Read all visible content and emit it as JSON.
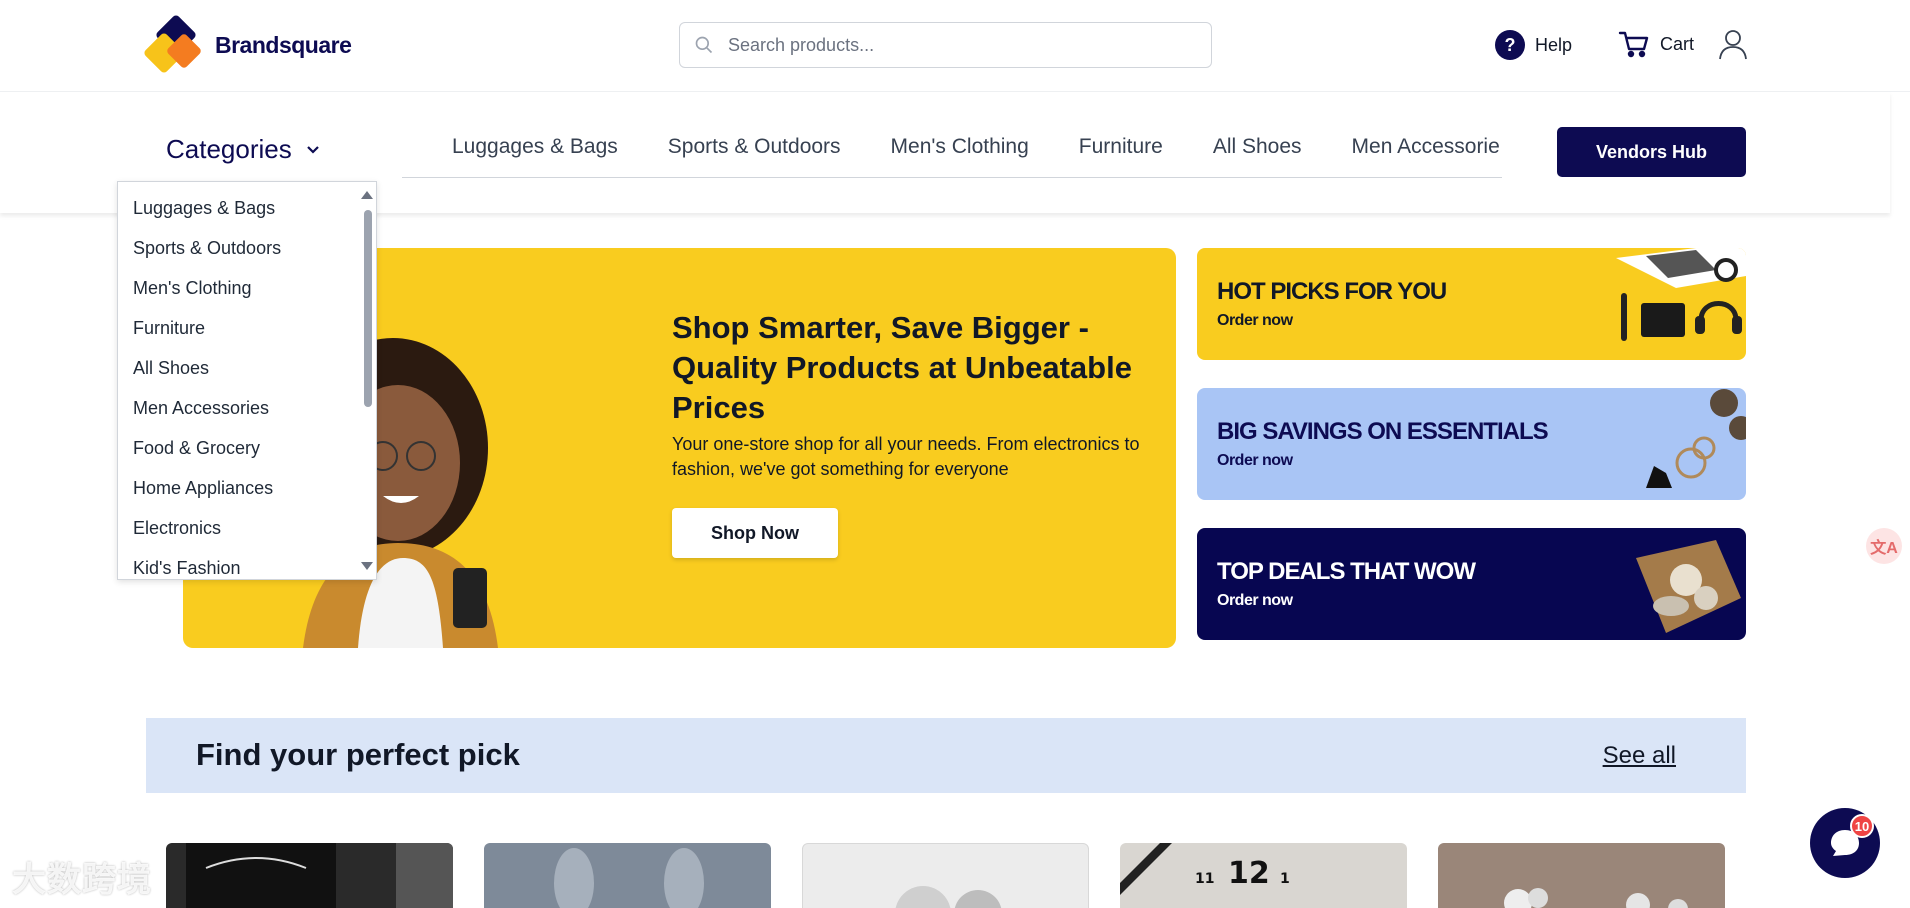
{
  "header": {
    "brand": "Brandsquare",
    "search_placeholder": "Search products...",
    "help_label": "Help",
    "cart_label": "Cart"
  },
  "nav": {
    "categories_label": "Categories",
    "links": [
      "Luggages & Bags",
      "Sports & Outdoors",
      "Men's Clothing",
      "Furniture",
      "All Shoes",
      "Men Accessorie"
    ],
    "vendors_label": "Vendors Hub"
  },
  "dropdown": {
    "items": [
      "Luggages & Bags",
      "Sports & Outdoors",
      "Men's Clothing",
      "Furniture",
      "All Shoes",
      "Men Accessories",
      "Food & Grocery",
      "Home Appliances",
      "Electronics",
      "Kid's Fashion"
    ]
  },
  "hero": {
    "title": "Shop Smarter, Save Bigger - Quality Products at Unbeatable Prices",
    "subtitle": "Your one-store shop for all your needs. From electronics to fashion, we've got something for everyone",
    "cta": "Shop Now"
  },
  "promos": [
    {
      "title": "HOT PICKS FOR YOU",
      "sub": "Order now"
    },
    {
      "title": "BIG SAVINGS ON ESSENTIALS",
      "sub": "Order now"
    },
    {
      "title": "TOP DEALS THAT WOW",
      "sub": "Order now"
    }
  ],
  "find": {
    "title": "Find your perfect pick",
    "see_all": "See all"
  },
  "chat": {
    "badge": "10"
  },
  "translate_glyph": "文A",
  "watermark": "大数跨境",
  "colors": {
    "brand_navy": "#0d0b52",
    "brand_yellow": "#f9cc1f",
    "brand_orange": "#f47c20",
    "light_blue": "#a9c5f5",
    "section_bg": "#dae5f7"
  }
}
